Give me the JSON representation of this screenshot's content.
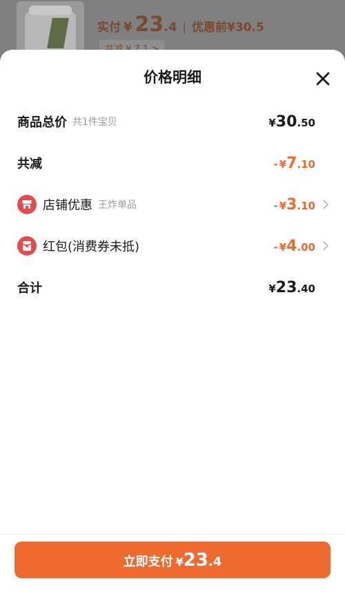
{
  "background": {
    "paid_label": "实付",
    "currency": "¥",
    "price_int": "23",
    "price_dec": ".4",
    "separator": "|",
    "original_label": "优惠前",
    "original_price": "¥30.5",
    "saved_text": "共减 ¥ 7.1 >"
  },
  "sheet": {
    "title": "价格明细",
    "close_icon": "close-icon",
    "rows": {
      "goods_total": {
        "label": "商品总价",
        "sub": "共1件宝贝",
        "currency": "¥",
        "int": "30",
        "dec": ".50"
      },
      "total_discount": {
        "label": "共减",
        "minus": "-",
        "currency": "¥",
        "int": "7",
        "dec": ".10"
      },
      "shop_discount": {
        "label": "店铺优惠",
        "sub": "王炸单品",
        "icon": "store-icon",
        "minus": "-",
        "currency": "¥",
        "int": "3",
        "dec": ".10"
      },
      "red_packet": {
        "label": "红包(消费券未抵)",
        "icon": "red-packet-icon",
        "minus": "-",
        "currency": "¥",
        "int": "4",
        "dec": ".00"
      },
      "subtotal": {
        "label": "合计",
        "currency": "¥",
        "int": "23",
        "dec": ".40"
      }
    }
  },
  "pay_button": {
    "label": "立即支付",
    "currency": "¥",
    "int": "23",
    "dec": ".4"
  },
  "colors": {
    "accent": "#ef6a2f",
    "icon_red": "#e74a4a",
    "text": "#1a1a1a",
    "muted": "#999999"
  }
}
